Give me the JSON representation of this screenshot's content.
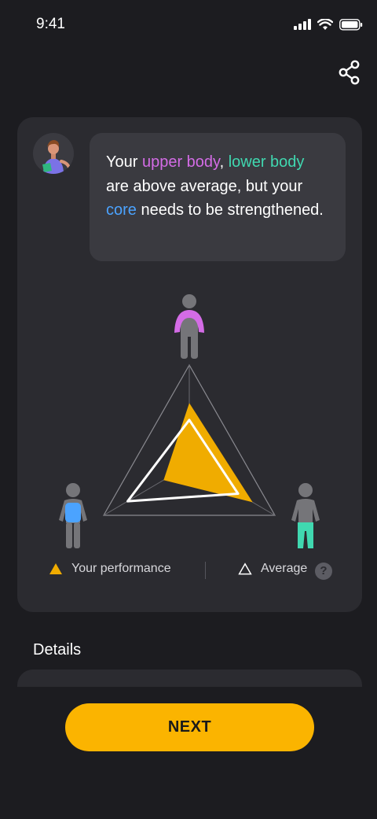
{
  "status_bar": {
    "time": "9:41"
  },
  "message": {
    "prefix": "Your ",
    "upper": "upper body",
    "comma": ", ",
    "lower": "lower body",
    "middle": " are above average, but your ",
    "core": "core",
    "suffix": " needs to be strengthened."
  },
  "colors": {
    "upper_body": "#d46ce6",
    "lower_body": "#40d8b0",
    "core": "#4ba3ff",
    "your_performance": "#f0ac00",
    "average": "#ffffff",
    "accent": "#fbb400"
  },
  "chart_data": {
    "type": "radar",
    "axes": [
      "upper body",
      "lower body",
      "core"
    ],
    "series": [
      {
        "name": "Your performance",
        "values": [
          0.62,
          0.74,
          0.3
        ]
      },
      {
        "name": "Average",
        "values": [
          0.45,
          0.57,
          0.72
        ]
      }
    ]
  },
  "legend": {
    "performance_label": "Your performance",
    "average_label": "Average",
    "help": "?"
  },
  "details": {
    "title": "Details"
  },
  "next_button": {
    "label": "NEXT"
  }
}
